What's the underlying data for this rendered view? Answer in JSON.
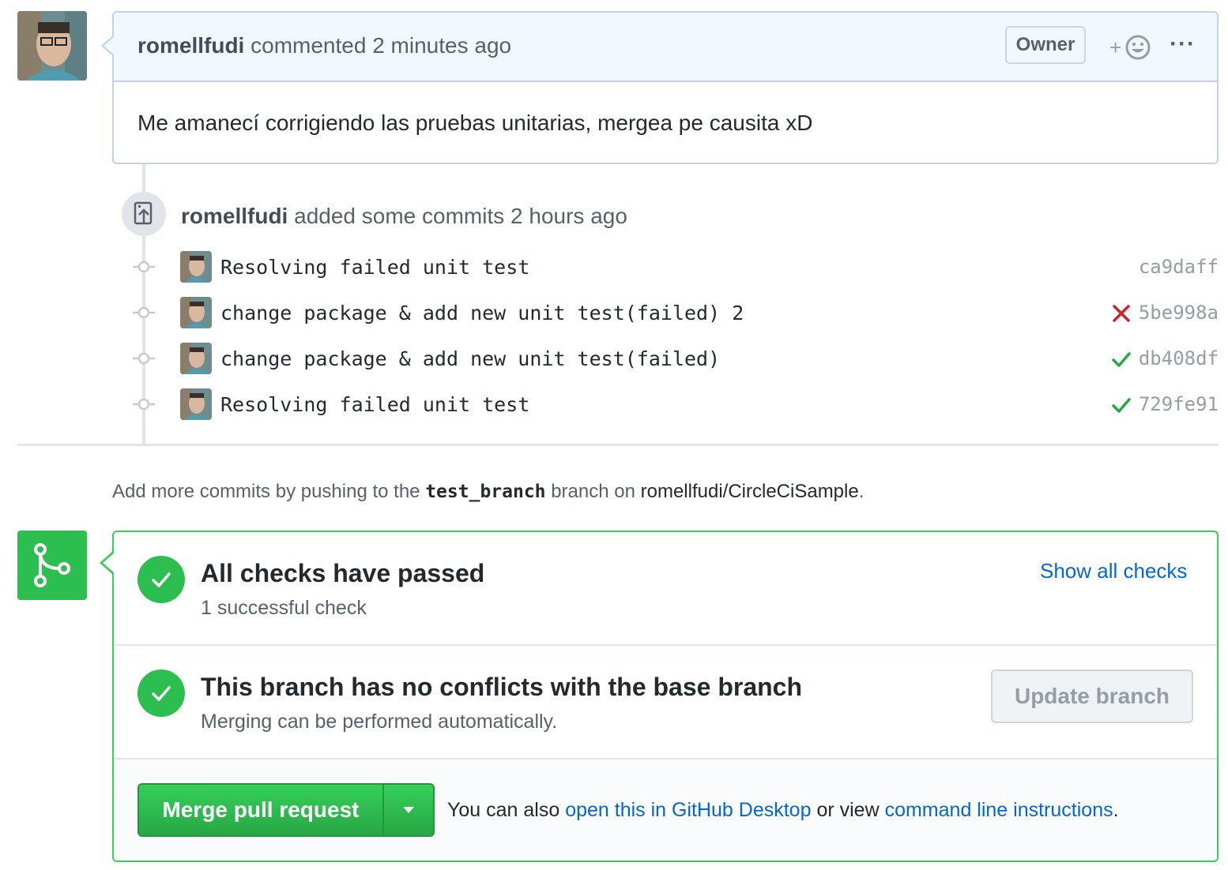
{
  "comment": {
    "author": "romellfudi",
    "action": "commented",
    "time": "2 minutes ago",
    "badge": "Owner",
    "reaction_plus": "+",
    "more": "···",
    "body": "Me amanecí corrigiendo las pruebas unitarias, mergea pe causita xD"
  },
  "commits_event": {
    "author": "romellfudi",
    "action": "added some commits",
    "time": "2 hours ago"
  },
  "commits": [
    {
      "message": "Resolving failed unit test",
      "sha": "ca9daff",
      "status": "none"
    },
    {
      "message": "change package & add new unit test(failed) 2",
      "sha": "5be998a",
      "status": "failure"
    },
    {
      "message": "change package & add new unit test(failed)",
      "sha": "db408df",
      "status": "success"
    },
    {
      "message": "Resolving failed unit test",
      "sha": "729fe91",
      "status": "success"
    }
  ],
  "push_note": {
    "prefix": "Add more commits by pushing to the",
    "branch": "test_branch",
    "middle": "branch on",
    "repo": "romellfudi/CircleCiSample",
    "suffix": "."
  },
  "checks": {
    "title": "All checks have passed",
    "subtitle": "1 successful check",
    "show_all": "Show all checks"
  },
  "conflicts": {
    "title": "This branch has no conflicts with the base branch",
    "subtitle": "Merging can be performed automatically.",
    "update_button": "Update branch"
  },
  "merge": {
    "button": "Merge pull request",
    "note_prefix": "You can also",
    "desktop_link": "open this in GitHub Desktop",
    "note_middle": "or view",
    "cli_link": "command line instructions",
    "note_suffix": "."
  },
  "colors": {
    "success": "#28a745",
    "failure": "#cb2431",
    "link": "#0366d6",
    "comment_header_bg": "#f1f8ff"
  },
  "icons": {
    "push": "repo-push-icon",
    "merge": "git-merge-icon",
    "reaction": "smiley-icon",
    "commit": "git-commit-icon",
    "check": "check-icon",
    "x": "x-icon",
    "caret": "triangle-down-icon"
  }
}
